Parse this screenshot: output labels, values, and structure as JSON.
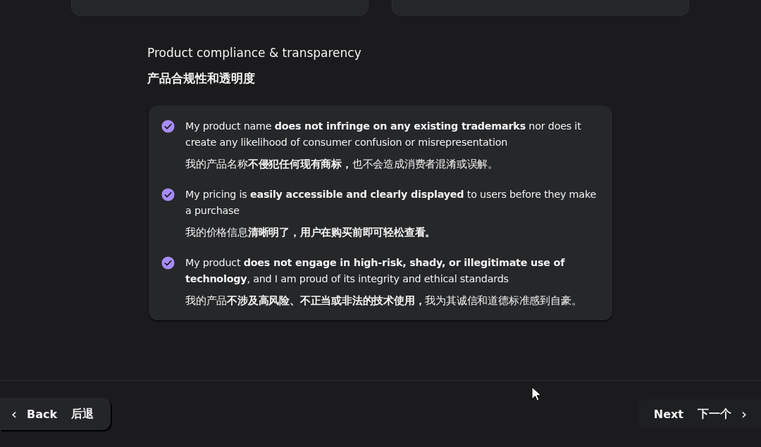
{
  "top_cards": [
    {
      "kind": "card"
    },
    {
      "kind": "card"
    }
  ],
  "section": {
    "title": "Product compliance & transparency",
    "title_zh": "产品合规性和透明度"
  },
  "items": [
    {
      "checked": true,
      "text": "My product name **does not infringe on any existing trademarks** nor does it create any likelihood of consumer confusion or misrepresentation",
      "text_zh": "我的产品名称**不侵犯任何现有商标，**也不会造成消费者混淆或误解。"
    },
    {
      "checked": true,
      "text": "My pricing is **easily accessible and clearly displayed** to users before they make a purchase",
      "text_zh": "我的价格信息**清晰明了，用户在购买前即可轻松查看。**"
    },
    {
      "checked": true,
      "text": "My product **does not engage in high-risk, shady, or illegitimate use of technology**, and I am proud of its integrity and ethical standards",
      "text_zh": "我的产品**不涉及高风险、不正当或非法的技术使用，**我为其诚信和道德标准感到自豪。"
    }
  ],
  "footer": {
    "back": {
      "label": "Back",
      "label_zh": "后退",
      "icon": "‹"
    },
    "next": {
      "label": "Next",
      "label_zh": "下一个",
      "icon": "›"
    }
  }
}
